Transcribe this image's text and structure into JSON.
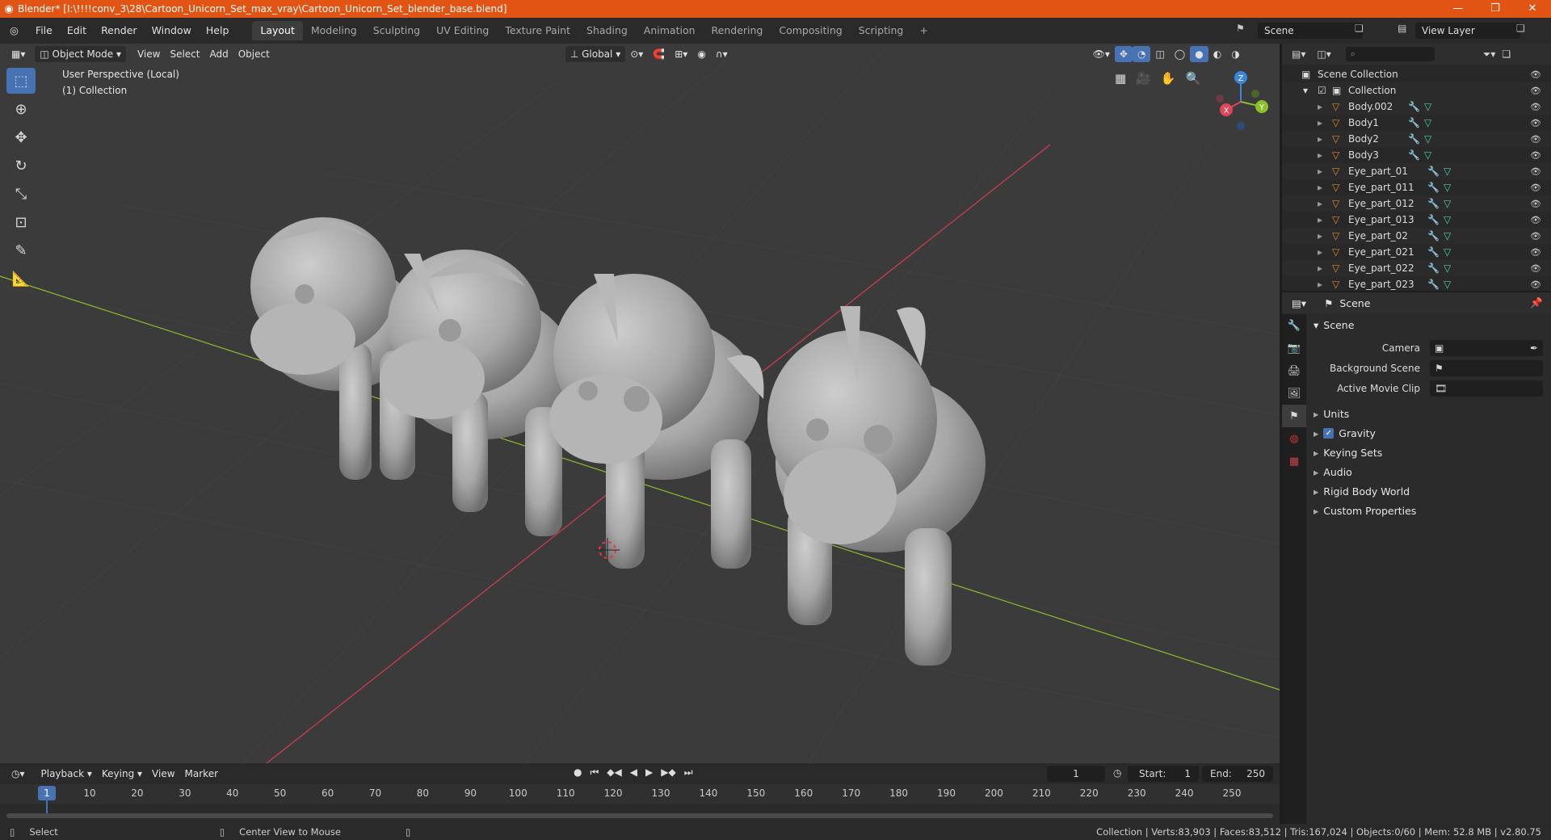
{
  "window": {
    "title": "Blender* [I:\\!!!!conv_3\\28\\Cartoon_Unicorn_Set_max_vray\\Cartoon_Unicorn_Set_blender_base.blend]",
    "minimize": "—",
    "maximize": "❐",
    "close": "✕"
  },
  "menu": [
    "File",
    "Edit",
    "Render",
    "Window",
    "Help"
  ],
  "workspaces": [
    "Layout",
    "Modeling",
    "Sculpting",
    "UV Editing",
    "Texture Paint",
    "Shading",
    "Animation",
    "Rendering",
    "Compositing",
    "Scripting"
  ],
  "active_workspace": "Layout",
  "topright": {
    "scene": "Scene",
    "view_layer": "View Layer"
  },
  "viewport_header": {
    "mode": "Object Mode",
    "menus": [
      "View",
      "Select",
      "Add",
      "Object"
    ],
    "transform": "Global"
  },
  "viewport": {
    "perspective": "User Perspective (Local)",
    "collection": "(1) Collection",
    "gizmo": {
      "x": "X",
      "y": "Y",
      "z": "Z"
    }
  },
  "outliner": {
    "root": "Scene Collection",
    "collection": "Collection",
    "items": [
      "Body.002",
      "Body1",
      "Body2",
      "Body3",
      "Eye_part_01",
      "Eye_part_011",
      "Eye_part_012",
      "Eye_part_013",
      "Eye_part_02",
      "Eye_part_021",
      "Eye_part_022",
      "Eye_part_023"
    ]
  },
  "properties": {
    "context": "Scene",
    "panel": "Scene",
    "fields": {
      "camera": "Camera",
      "background_scene": "Background Scene",
      "active_clip": "Active Movie Clip"
    },
    "sections": [
      "Units",
      "Gravity",
      "Keying Sets",
      "Audio",
      "Rigid Body World",
      "Custom Properties"
    ],
    "gravity_checked": true
  },
  "timeline": {
    "menus": [
      "Playback",
      "Keying",
      "View",
      "Marker"
    ],
    "current_frame": "1",
    "start_label": "Start:",
    "start": "1",
    "end_label": "End:",
    "end": "250",
    "ticks": [
      "1",
      "10",
      "20",
      "30",
      "40",
      "50",
      "60",
      "70",
      "80",
      "90",
      "100",
      "110",
      "120",
      "130",
      "140",
      "150",
      "160",
      "170",
      "180",
      "190",
      "200",
      "210",
      "220",
      "230",
      "240",
      "250"
    ]
  },
  "statusbar": {
    "left": "Select",
    "middle": "Center View to Mouse",
    "right": "Collection | Verts:83,903 | Faces:83,512 | Tris:167,024 | Objects:0/60 | Mem: 52.8 MB | v2.80.75"
  },
  "colors": {
    "title_bar": "#e25413",
    "accent": "#4772b3",
    "x_axis": "#e0455a",
    "y_axis": "#8bbf2b",
    "z_axis": "#3b86db"
  }
}
